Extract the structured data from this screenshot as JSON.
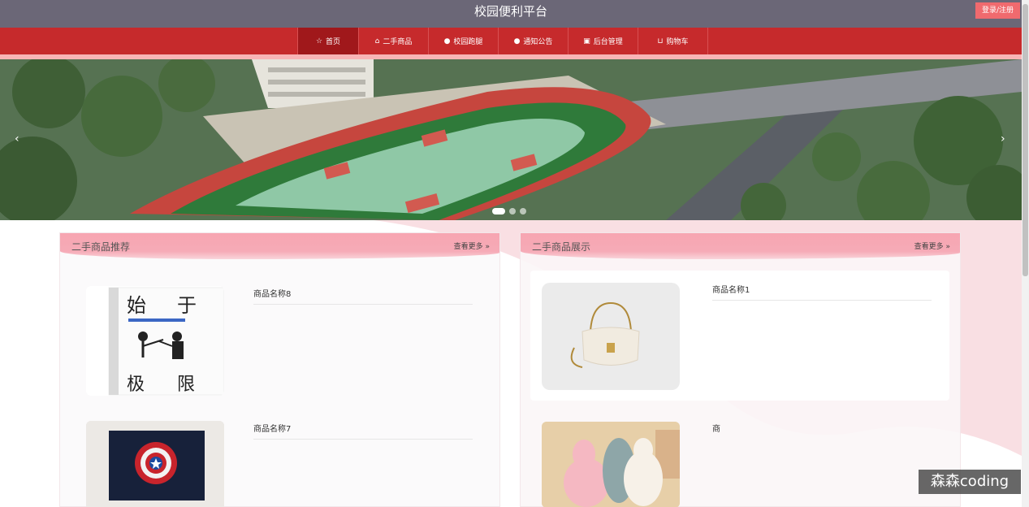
{
  "header": {
    "title": "校园便利平台",
    "login_label": "登录/注册"
  },
  "nav": {
    "items": [
      {
        "label": "首页",
        "icon": "star-icon",
        "active": true
      },
      {
        "label": "二手商品",
        "icon": "shop-icon",
        "active": false
      },
      {
        "label": "校园跑腿",
        "icon": "info-icon",
        "active": false
      },
      {
        "label": "通知公告",
        "icon": "question-icon",
        "active": false
      },
      {
        "label": "后台管理",
        "icon": "box-icon",
        "active": false
      },
      {
        "label": "购物车",
        "icon": "cart-icon",
        "active": false
      }
    ]
  },
  "banner": {
    "prev": "‹",
    "next": "›",
    "slide_count": 3,
    "active_slide": 0
  },
  "left_panel": {
    "title": "二手商品推荐",
    "more": "查看更多",
    "items": [
      {
        "name": "商品名称8"
      },
      {
        "name": "商品名称7"
      }
    ],
    "book_text": {
      "t1": "始",
      "t2": "于",
      "t3": "极",
      "t4": "限"
    }
  },
  "right_panel": {
    "title": "二手商品展示",
    "more": "查看更多",
    "items": [
      {
        "name": "商品名称1"
      },
      {
        "name": "商"
      }
    ]
  },
  "watermark": "森森coding",
  "colors": {
    "nav": "#c62a2c",
    "topbar": "#6b6777",
    "accent_pink": "#f7a5b1"
  }
}
